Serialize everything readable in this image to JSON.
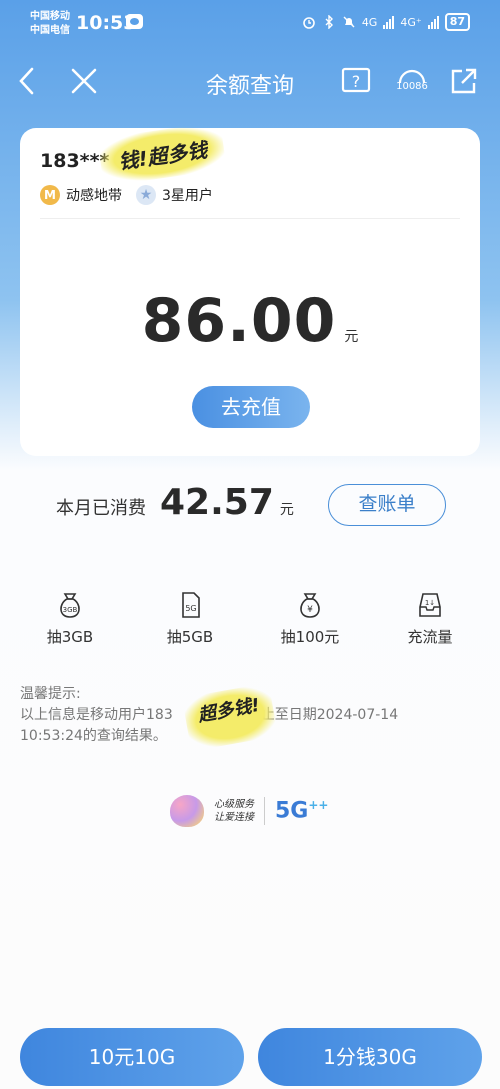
{
  "status_bar": {
    "carrier_1": "中国移动",
    "carrier_2": "中国电信",
    "time": "10:53",
    "network_1": "4G",
    "network_2": "4G⁺",
    "battery": "87"
  },
  "nav": {
    "title": "余额查询",
    "service_number": "10086"
  },
  "account": {
    "phone_prefix": "183***",
    "sticker_text": "钱!超多钱",
    "tag_1_icon": "M",
    "tag_1": "动感地带",
    "tag_2": "3星用户"
  },
  "balance": {
    "amount": "86.00",
    "unit": "元",
    "recharge_label": "去充值"
  },
  "monthly": {
    "label": "本月已消费",
    "amount": "42.57",
    "unit": "元",
    "bill_button": "查账单"
  },
  "quick_actions": [
    {
      "label": "抽3GB",
      "icon_text": "3GB",
      "icon": "money-bag-icon"
    },
    {
      "label": "抽5GB",
      "icon_text": "5G",
      "icon": "sim-card-icon"
    },
    {
      "label": "抽100元",
      "icon_text": "¥",
      "icon": "money-bag-icon"
    },
    {
      "label": "充流量",
      "icon_text": "1↓",
      "icon": "data-tray-icon"
    }
  ],
  "tip": {
    "title": "温馨提示:",
    "line_1": "以上信息是移动用户183",
    "line_1_end": "止至日期2024-07-14",
    "line_2": "10:53:24的查询结果。",
    "sticker_text": "超多钱!"
  },
  "brand": {
    "slogan_1": "心级服务",
    "slogan_2": "让爱连接",
    "logo": "5G",
    "logo_sup": "++"
  },
  "bottom_buttons": {
    "left": "10元10G",
    "right": "1分钱30G"
  },
  "colors": {
    "accent": "#4a90e2",
    "header_top": "#5aa0e8",
    "sticker": "#f4ec6a"
  }
}
